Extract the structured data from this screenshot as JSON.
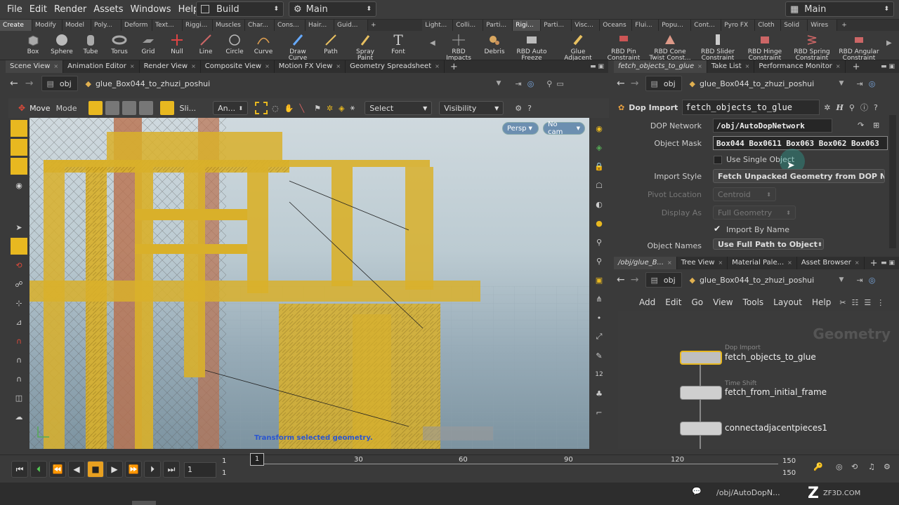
{
  "menu": [
    "File",
    "Edit",
    "Render",
    "Assets",
    "Windows",
    "Help"
  ],
  "desktop_left": "Build",
  "desktop_mid": "Main",
  "desktop_right": "Main",
  "shelf_tabs_left": [
    "Create",
    "Modify",
    "Model",
    "Poly...",
    "Deform",
    "Text...",
    "Riggi...",
    "Muscles",
    "Char...",
    "Cons...",
    "Hair...",
    "Guid..."
  ],
  "shelf_tabs_right": [
    "Light...",
    "Colli...",
    "Parti...",
    "Rigi...",
    "Parti...",
    "Visc...",
    "Oceans",
    "Flui...",
    "Popu...",
    "Cont...",
    "Pyro FX",
    "Cloth",
    "Solid",
    "Wires"
  ],
  "tools_left": [
    "Box",
    "Sphere",
    "Tube",
    "Torus",
    "Grid",
    "Null",
    "Line",
    "Circle",
    "Curve",
    "Draw Curve",
    "Path",
    "Spray Paint",
    "Font"
  ],
  "tools_right": [
    "RBD Impacts",
    "Debris",
    "RBD Auto Freeze",
    "Glue Adjacent",
    "RBD Pin Constraint",
    "RBD Cone Twist Const...",
    "RBD Slider Constraint",
    "RBD Hinge Constraint",
    "RBD Spring Constraint",
    "RBD Angular Constraint"
  ],
  "left_tabs": [
    "Scene View",
    "Animation Editor",
    "Render View",
    "Composite View",
    "Motion FX View",
    "Geometry Spreadsheet"
  ],
  "right_tabs": [
    "fetch_objects_to_glue",
    "Take List",
    "Performance Monitor"
  ],
  "path": {
    "root": "obj",
    "node": "glue_Box044_to_zhuzi_poshui"
  },
  "viewport": {
    "tool": "Move",
    "mode": "Mode",
    "sli": "Sli...",
    "an": "An...",
    "select": "Select",
    "visibility": "Visibility",
    "persp": "Persp",
    "cam": "No cam",
    "hint": "Transform selected geometry."
  },
  "params": {
    "node_type": "Dop Import",
    "node_name": "fetch_objects_to_glue",
    "dop_network_label": "DOP Network",
    "dop_network": "/obj/AutoDopNetwork",
    "object_mask_label": "Object Mask",
    "object_mask": "Box044 Box0611 Box063 Box062 Box063",
    "use_single": "Use Single Object",
    "import_style_label": "Import Style",
    "import_style": "Fetch Unpacked Geometry from DOP Ne...",
    "pivot_label": "Pivot Location",
    "pivot": "Centroid",
    "display_label": "Display As",
    "display": "Full Geometry",
    "import_by_name": "Import By Name",
    "object_names_label": "Object Names",
    "object_names": "Use Full Path to Object"
  },
  "net_tabs": [
    "/obj/glue_B...",
    "Tree View",
    "Material Pale...",
    "Asset Browser"
  ],
  "net_menu": [
    "Add",
    "Edit",
    "Go",
    "View",
    "Tools",
    "Layout",
    "Help"
  ],
  "net_context": "Geometry",
  "nodes": [
    {
      "type": "Dop Import",
      "name": "fetch_objects_to_glue"
    },
    {
      "type": "Time Shift",
      "name": "fetch_from_initial_frame"
    },
    {
      "type": "",
      "name": "connectadjacentpieces1"
    }
  ],
  "timeline": {
    "current": "1",
    "start": "1",
    "start2": "1",
    "marker": "1",
    "ticks": [
      "30",
      "60",
      "90",
      "120"
    ],
    "end": "150",
    "end2": "150"
  },
  "status": {
    "path": "/obj/AutoDopN...",
    "watermark": "ZF3D.COM"
  },
  "colors": {
    "accent": "#e8b820",
    "geometry": "#d9b02a",
    "select": "#f2c14b"
  }
}
